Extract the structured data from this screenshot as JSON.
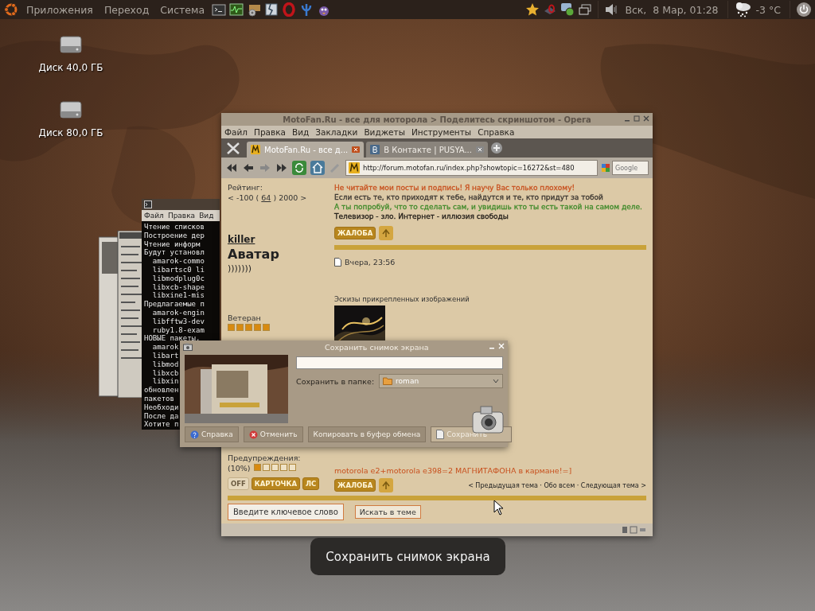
{
  "top_panel": {
    "menus": [
      "Приложения",
      "Переход",
      "Система"
    ],
    "clock": "Вск,  8 Мар, 01:28",
    "temperature": "-3 °C"
  },
  "desktop_icons": [
    {
      "label": "Диск 40,0 ГБ"
    },
    {
      "label": "Диск 80,0 ГБ"
    }
  ],
  "terminal": {
    "menus": [
      "Файл",
      "Правка",
      "Вид"
    ],
    "lines": [
      "Чтение списков",
      "Построение дер",
      "Чтение информ",
      "Будут установл",
      "  amarok-commo",
      "  libartsc0 li",
      "  libmodplug0c",
      "  libxcb-shape",
      "  libxine1-mis",
      "Предлагаемые п",
      "  amarok-engin",
      "  libfftw3-dev",
      "  ruby1.8-exam",
      "НОВЫЕ пакеты,",
      "  amarok",
      "  libart",
      "  libmod",
      "  libxcb",
      "  libxin",
      "обновлен",
      "пакетов",
      "Необходи",
      "После да",
      "Хотите п"
    ]
  },
  "browser": {
    "title": "MotoFan.Ru - все для моторола > Поделитесь скриншотом - Opera",
    "menus": [
      "Файл",
      "Правка",
      "Вид",
      "Закладки",
      "Виджеты",
      "Инструменты",
      "Справка"
    ],
    "tabs": [
      {
        "label": "MotoFan.Ru - все д...",
        "selected": true
      },
      {
        "label": "В Контакте | PUSYA...",
        "selected": false
      }
    ],
    "address": "http://forum.motofan.ru/index.php?showtopic=16272&st=480",
    "search_placeholder": "Google",
    "prev_rating": {
      "label": "Рейтинг:",
      "before": "< -100 ( ",
      "value": "64",
      "after": " ) 2000 >"
    },
    "signature": [
      {
        "text": "Не читайте мои посты и подпись! Я научу Вас только плохому!",
        "color": "#c8501e"
      },
      {
        "text": "Если есть те, кто приходят к тебе, найдутся и те, кто придут за тобой",
        "color": "#3a3530"
      },
      {
        "text": "А ты попробуй, что то сделать сам, и увидишь кто ты есть такой на самом деле.",
        "color": "#3f8a2a"
      },
      {
        "text": "Телевизор - зло. Интернет - иллюзия свободы",
        "color": "#1e1a16"
      }
    ],
    "post_buttons": [
      "ЖАЛОБА"
    ],
    "user": {
      "name": "killer",
      "avatar_label": "Аватар",
      "avatar_text": ")))))))",
      "rank": "Ветеран",
      "stars": 5
    },
    "post_date": "Вчера, 23:56",
    "attachments_label": "Эскизы прикрепленных изображений",
    "warnings": {
      "label": "Предупреждения:",
      "value": "(10%)",
      "stars": 1
    },
    "profile_buttons": [
      "OFF",
      "КАРТОЧКА",
      "ЛС"
    ],
    "post_text": "motorola e2+motorola e398=2 МАГНИТАФОНА в кармане!=]",
    "bottom_buttons": [
      "ЖАЛОБА"
    ],
    "topic_nav": "< Предыдущая тема · Обо всем · Следующая тема >",
    "search_field": "Введите ключевое слово",
    "search_button": "Искать в теме"
  },
  "screenshot_dialog": {
    "title": "Сохранить снимок экрана",
    "folder_label": "Сохранить в папке:",
    "folder": "roman",
    "buttons": [
      {
        "label": "Справка",
        "kind": "help"
      },
      {
        "label": "Отменить",
        "kind": "cancel"
      },
      {
        "label": "Копировать в буфер обмена",
        "kind": "plain"
      },
      {
        "label": "Сохранить",
        "kind": "save"
      }
    ]
  },
  "switcher_caption": "Сохранить снимок экрана"
}
